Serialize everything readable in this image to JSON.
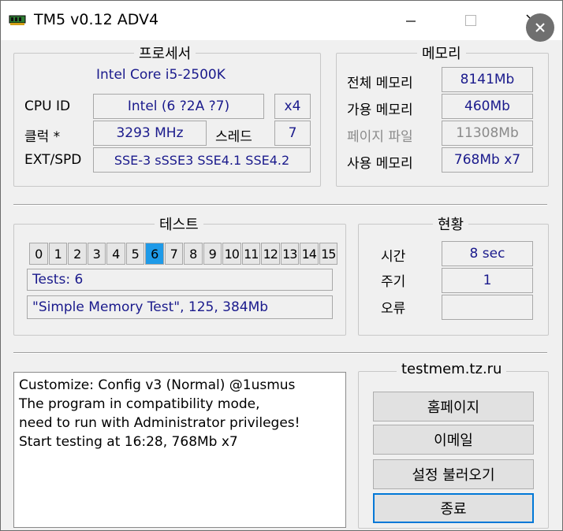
{
  "window": {
    "title": "TM5 v0.12 ADV4"
  },
  "processor": {
    "title": "프로세서",
    "cpu_name": "Intel Core i5-2500K",
    "cpu_id_label": "CPU ID",
    "cpu_id_value": "Intel  (6 ?2A ?7)",
    "cores": "x4",
    "clock_label": "클럭 *",
    "clock_value": "3293 MHz",
    "threads_label": "스레드",
    "threads_value": "7",
    "ext_label": "EXT/SPD",
    "ext_value": "SSE-3 sSSE3 SSE4.1 SSE4.2"
  },
  "memory": {
    "title": "메모리",
    "total_label": "전체 메모리",
    "total_value": "8141Mb",
    "available_label": "가용 메모리",
    "available_value": "460Mb",
    "pagefile_label": "페이지 파일",
    "pagefile_value": "11308Mb",
    "used_label": "사용 메모리",
    "used_value": "768Mb x7"
  },
  "test": {
    "title": "테스트",
    "cells": [
      "0",
      "1",
      "2",
      "3",
      "4",
      "5",
      "6",
      "7",
      "8",
      "9",
      "10",
      "11",
      "12",
      "13",
      "14",
      "15"
    ],
    "active_index": 6,
    "tests_text": "Tests: 6",
    "current_test": "\"Simple Memory Test\", 125, 384Mb"
  },
  "status": {
    "title": "현황",
    "time_label": "시간",
    "time_value": "8 sec",
    "cycle_label": "주기",
    "cycle_value": "1",
    "error_label": "오류",
    "error_value": ""
  },
  "log": {
    "lines": [
      "Customize: Config v3 (Normal) @1usmus",
      "The program in compatibility mode,",
      "need to run with Administrator privileges!",
      "Start testing at 16:28, 768Mb x7"
    ]
  },
  "actions": {
    "title": "testmem.tz.ru",
    "homepage": "홈페이지",
    "email": "이메일",
    "load_settings": "설정 불러오기",
    "exit": "종료"
  }
}
